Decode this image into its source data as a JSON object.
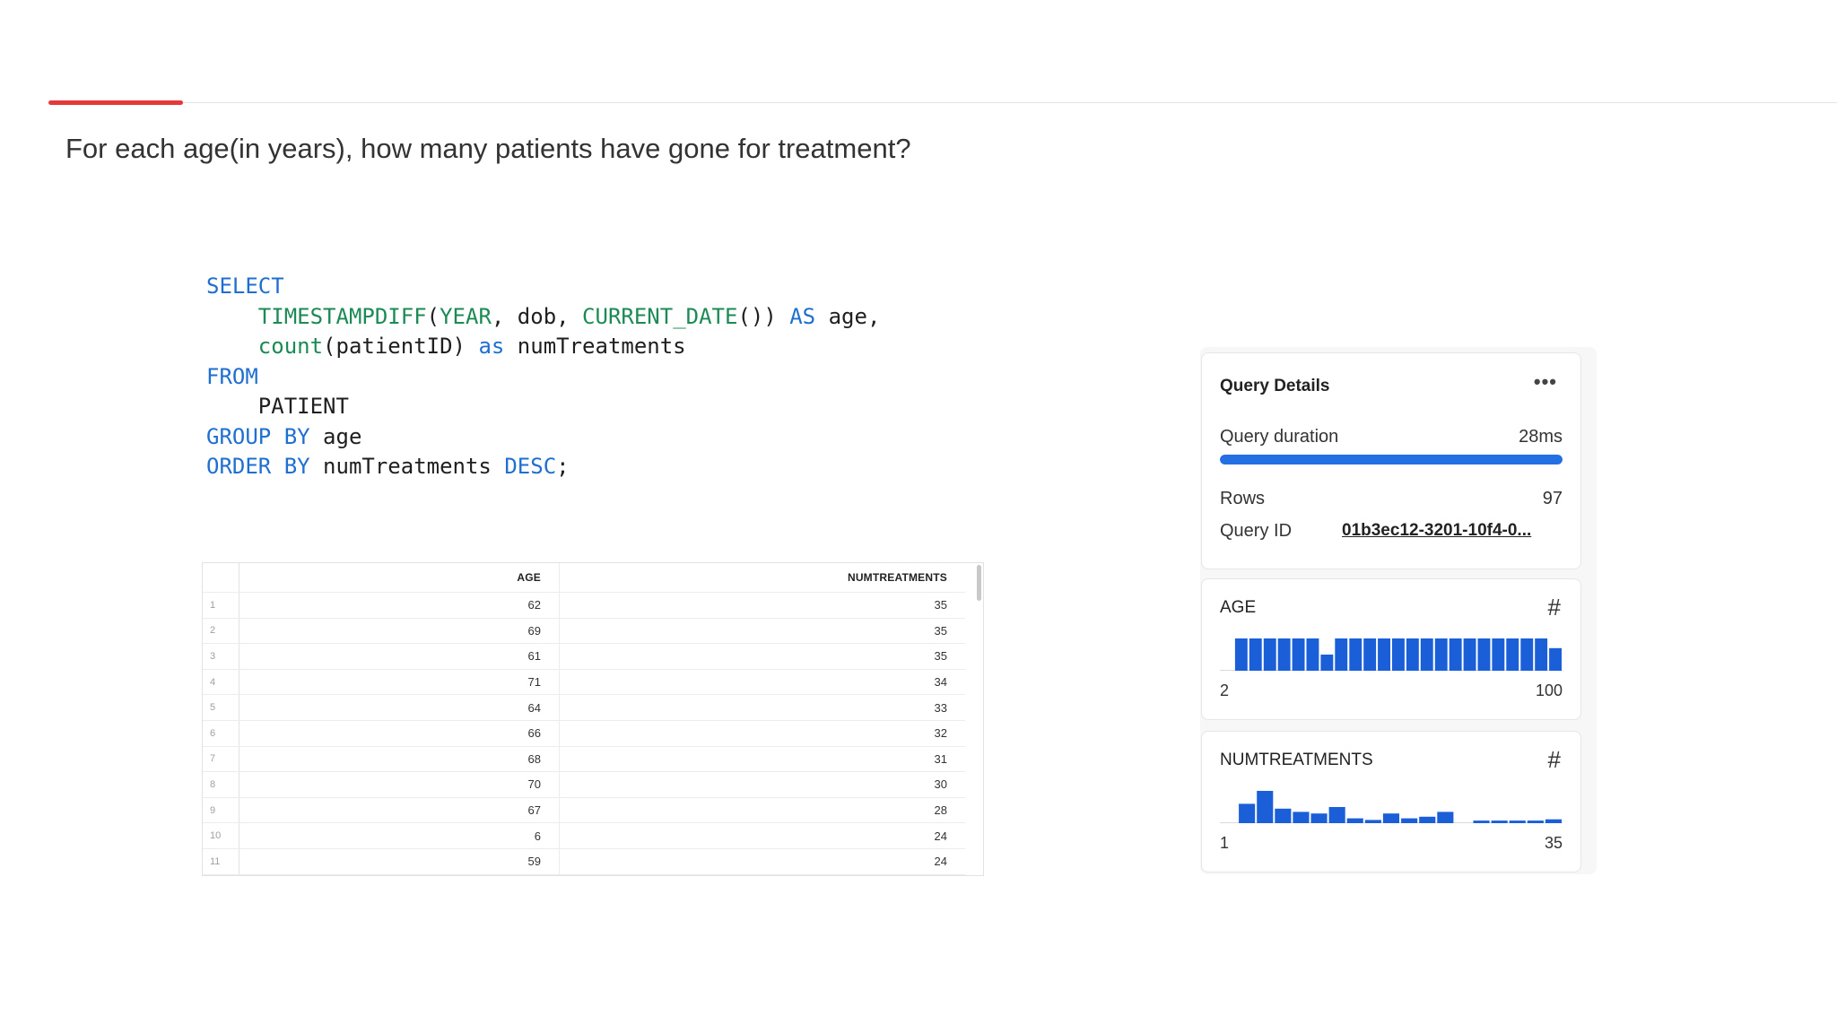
{
  "question": "For each age(in years), how many patients have gone for treatment?",
  "sql": {
    "kw_select": "SELECT",
    "fn_timestampdiff": "TIMESTAMPDIFF",
    "paren_open": "(",
    "fn_year": "YEAR",
    "sep_dob": ", dob, ",
    "fn_current_date": "CURRENT_DATE",
    "paren_close": "()) ",
    "kw_as1": "AS",
    "alias_age": " age,",
    "fn_count": "count",
    "count_arg": "(patientID) ",
    "kw_as2": "as",
    "alias_num": " numTreatments",
    "kw_from": "FROM",
    "table_name": "PATIENT",
    "kw_group_by": "GROUP BY",
    "group_col": " age",
    "kw_order_by": "ORDER BY",
    "order_col": " numTreatments ",
    "kw_desc": "DESC",
    "semicolon": ";"
  },
  "results": {
    "columns": [
      "AGE",
      "NUMTREATMENTS"
    ],
    "rows": [
      {
        "n": "1",
        "age": "62",
        "num": "35"
      },
      {
        "n": "2",
        "age": "69",
        "num": "35"
      },
      {
        "n": "3",
        "age": "61",
        "num": "35"
      },
      {
        "n": "4",
        "age": "71",
        "num": "34"
      },
      {
        "n": "5",
        "age": "64",
        "num": "33"
      },
      {
        "n": "6",
        "age": "66",
        "num": "32"
      },
      {
        "n": "7",
        "age": "68",
        "num": "31"
      },
      {
        "n": "8",
        "age": "70",
        "num": "30"
      },
      {
        "n": "9",
        "age": "67",
        "num": "28"
      },
      {
        "n": "10",
        "age": "6",
        "num": "24"
      },
      {
        "n": "11",
        "age": "59",
        "num": "24"
      }
    ]
  },
  "query_details": {
    "title": "Query Details",
    "more_icon": "more-horizontal-icon",
    "duration_label": "Query duration",
    "duration_value": "28ms",
    "duration_progress": 1.0,
    "rows_label": "Rows",
    "rows_value": "97",
    "query_id_label": "Query ID",
    "query_id_value": "01b3ec12-3201-10f4-0..."
  },
  "column_stats": [
    {
      "name": "AGE",
      "type_icon": "hash-icon",
      "min": "2",
      "max": "100",
      "bars": [
        0,
        1,
        1,
        1,
        1,
        1,
        1,
        0.5,
        1,
        1,
        1,
        1,
        1,
        1,
        1,
        1,
        1,
        1,
        1,
        1,
        1,
        1,
        1,
        0.7
      ]
    },
    {
      "name": "NUMTREATMENTS",
      "type_icon": "hash-icon",
      "min": "1",
      "max": "35",
      "bars": [
        0,
        0.6,
        1,
        0.45,
        0.35,
        0.3,
        0.5,
        0.15,
        0.1,
        0.3,
        0.15,
        0.2,
        0.35,
        0,
        0.08,
        0.08,
        0.08,
        0.08,
        0.12
      ]
    }
  ],
  "colors": {
    "accent_red": "#e5383b",
    "keyword_blue": "#1f6fd1",
    "function_green": "#1c8a55",
    "bar_blue": "#1a5fd8"
  }
}
